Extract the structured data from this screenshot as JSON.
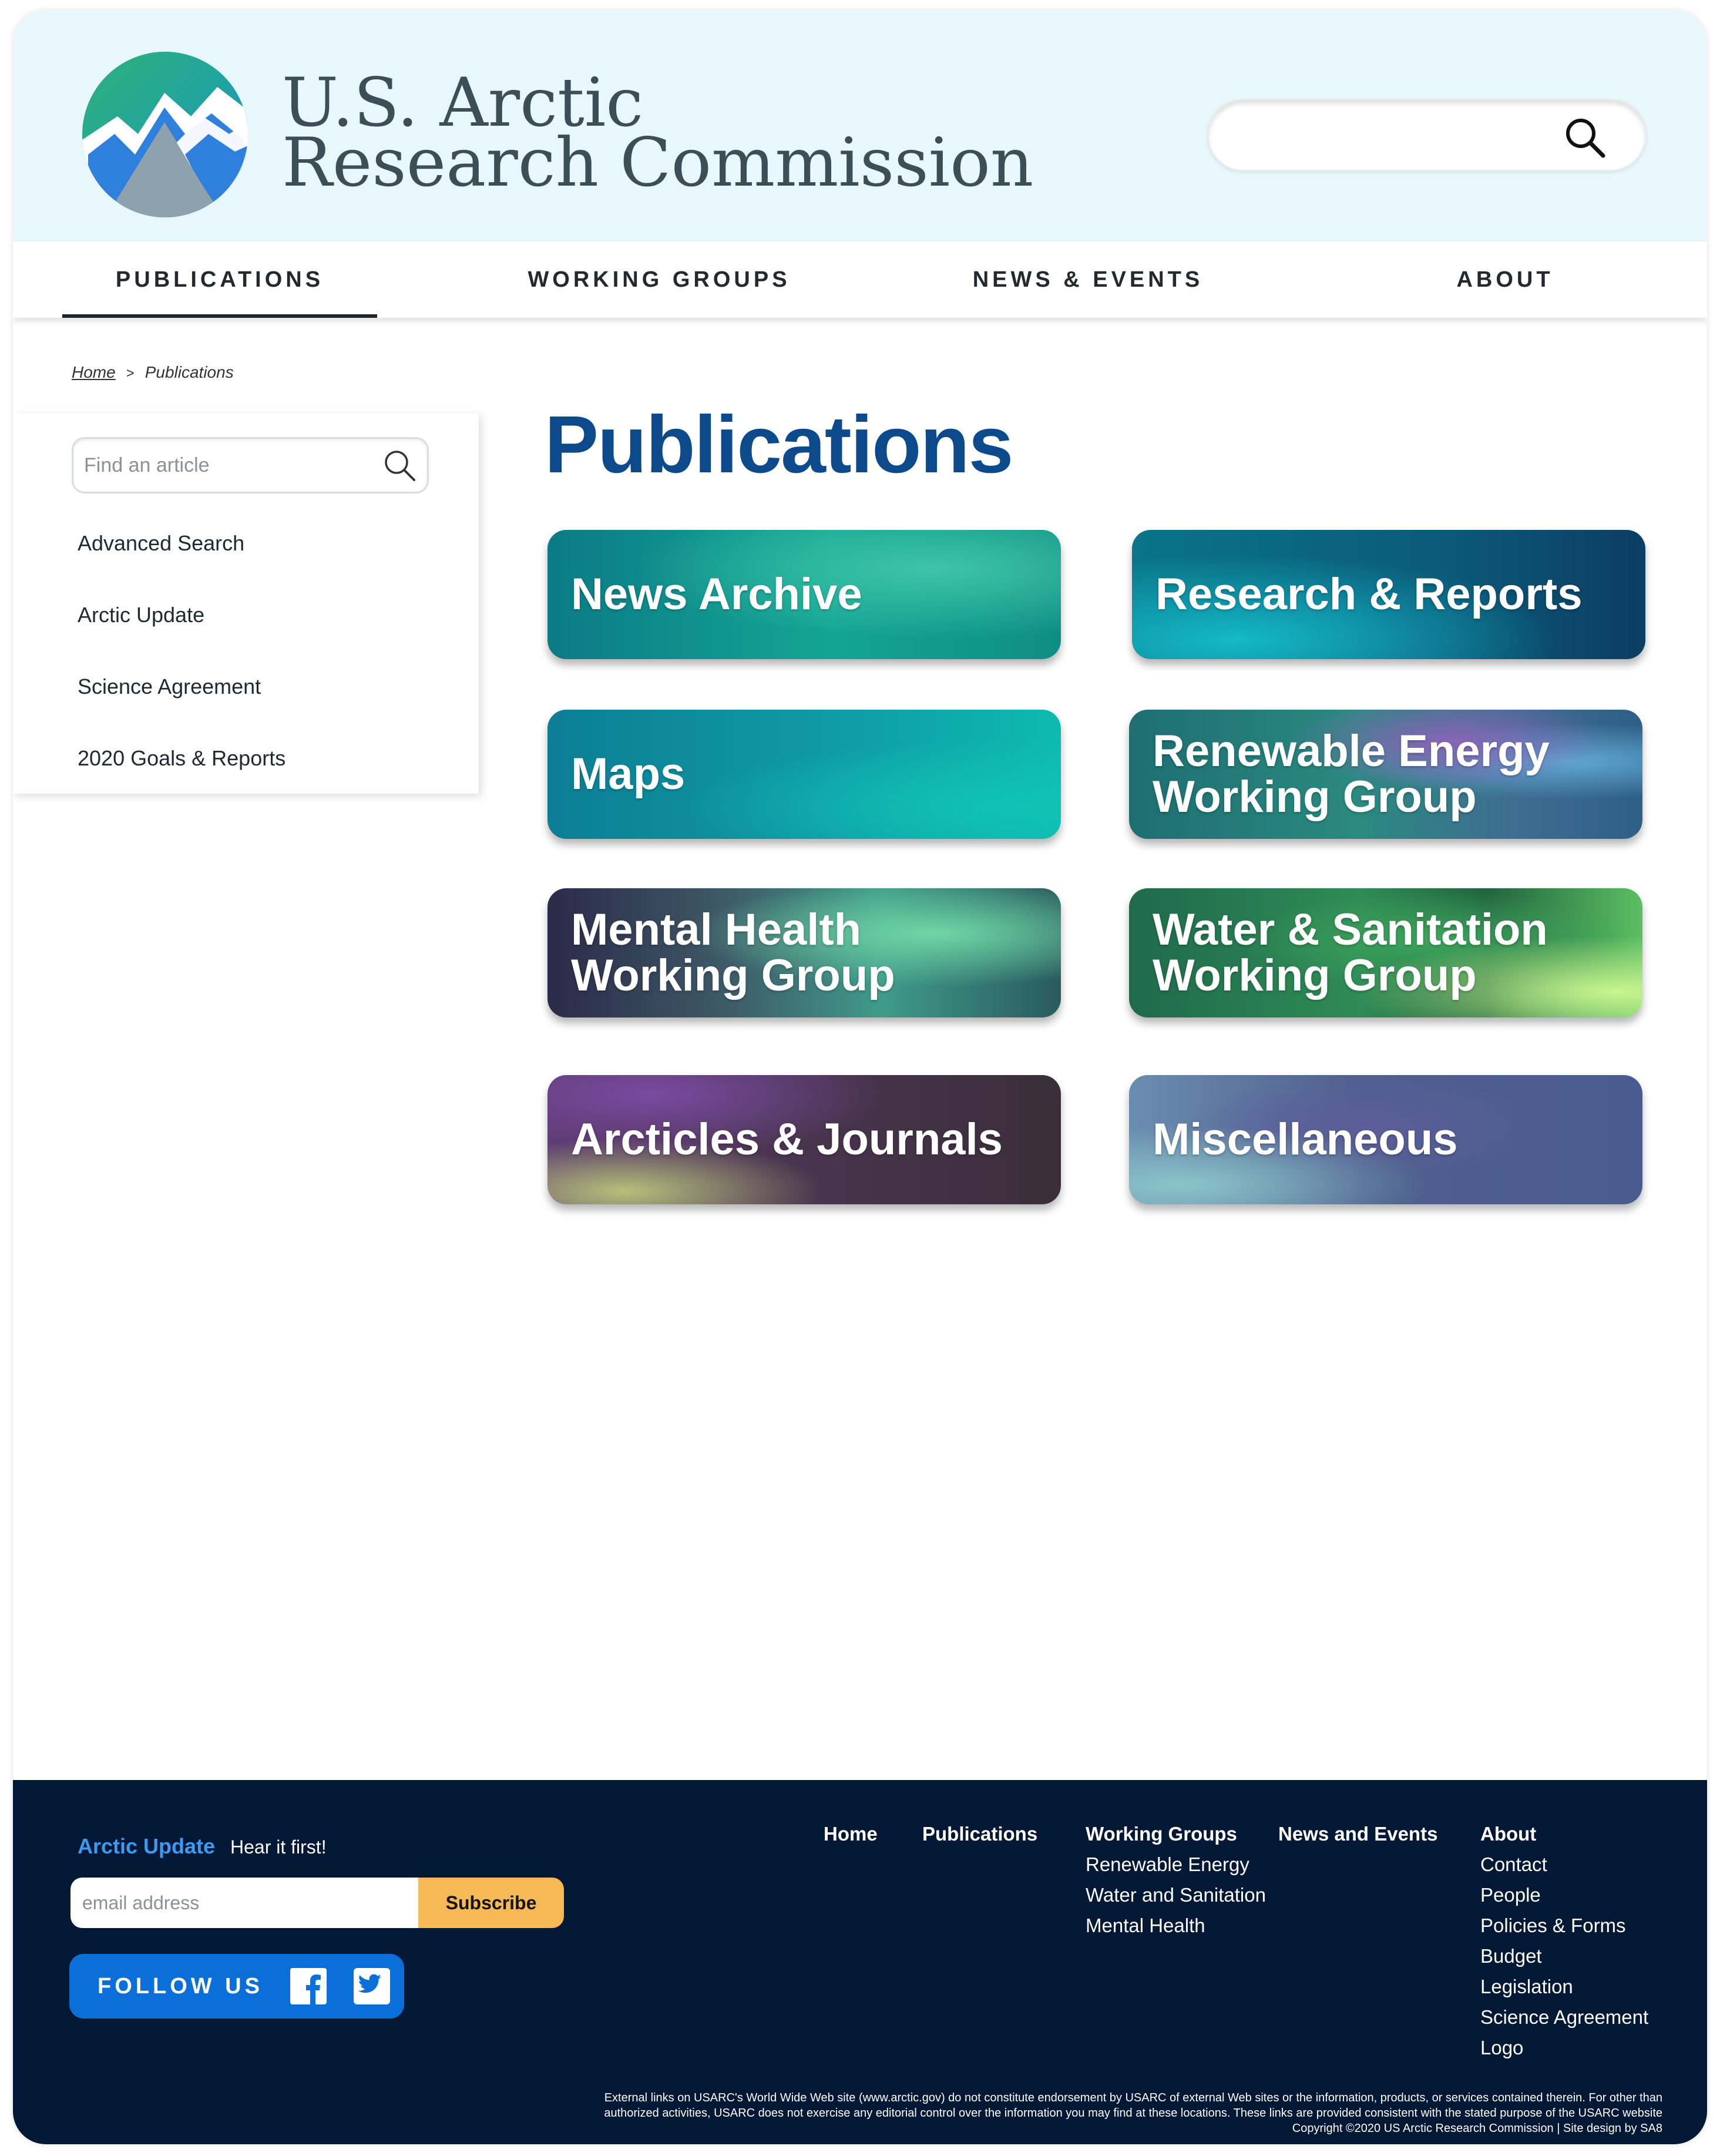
{
  "site": {
    "title_line1": "U.S. Arctic",
    "title_line2": "Research Commission",
    "search_placeholder": ""
  },
  "nav": [
    {
      "label": "PUBLICATIONS",
      "active": true
    },
    {
      "label": "WORKING GROUPS",
      "active": false
    },
    {
      "label": "NEWS & EVENTS",
      "active": false
    },
    {
      "label": "ABOUT",
      "active": false
    }
  ],
  "breadcrumb": {
    "home": "Home",
    "separator": ">",
    "current": "Publications"
  },
  "sidebar": {
    "search_placeholder": "Find an article",
    "links": [
      "Advanced Search",
      "Arctic Update",
      "Science Agreement",
      "2020 Goals & Reports"
    ]
  },
  "main": {
    "title": "Publications",
    "tiles": [
      {
        "label": "News Archive"
      },
      {
        "label": "Research & Reports"
      },
      {
        "label": "Maps"
      },
      {
        "label": "Renewable Energy Working Group"
      },
      {
        "label": "Mental Health Working Group"
      },
      {
        "label": "Water & Sanitation Working Group"
      },
      {
        "label": "Arcticles & Journals"
      },
      {
        "label": "Miscellaneous"
      }
    ]
  },
  "footer": {
    "brand": "Arctic Update",
    "tagline": "Hear it first!",
    "email_placeholder": "email address",
    "subscribe_label": "Subscribe",
    "follow_label": "FOLLOW US",
    "social_icons": [
      "facebook-icon",
      "twitter-icon"
    ],
    "columns": [
      {
        "heading": "Home",
        "items": []
      },
      {
        "heading": "Publications",
        "items": []
      },
      {
        "heading": "Working Groups",
        "items": [
          "Renewable Energy",
          "Water and Sanitation",
          "Mental Health"
        ]
      },
      {
        "heading": "News and Events",
        "items": []
      },
      {
        "heading": "About",
        "items": [
          "Contact",
          "People",
          "Policies  & Forms",
          "Budget",
          "Legislation",
          "Science Agreement",
          "Logo"
        ]
      }
    ],
    "legal_line1": "External links on USARC's World Wide Web site (www.arctic.gov) do not constitute endorsement by USARC of external Web sites or the information, products, or services contained therein. For other than",
    "legal_line2": "authorized activities, USARC does not exercise any editorial control over the information you may find at these locations. These links are provided consistent with the stated purpose of the USARC website",
    "legal_line3": "Copyright ©2020 US Arctic Research Commission | Site design by SA8"
  },
  "colors": {
    "header_bg": "#e8f7fc",
    "title_blue": "#0d4a8c",
    "footer_bg": "#021834",
    "footer_brand": "#3c9bf0",
    "subscribe": "#f7b955",
    "follow_button": "#0a6fd8"
  }
}
